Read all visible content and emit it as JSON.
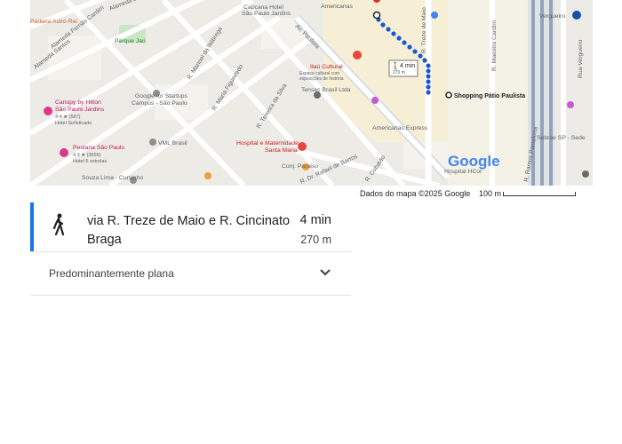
{
  "map": {
    "labels": {
      "alameda_jau": "Alameda Jaú",
      "parque_jau": "Parque Jaú",
      "ferraz": "Alameda Fernão Cardim",
      "santos": "Alameda Santos",
      "astro": "Padaria Astro Rei",
      "canopy_1": "Canopy by Hilton",
      "canopy_2": "São Paulo Jardins",
      "canopy_3": "4.4 ★ (587)",
      "canopy_4": "Hotel Sofisticado",
      "pestana_1": "Pestana São Paulo",
      "pestana_2": "4.3 ★ (3556)",
      "pestana_3": "Hotel 5 estrelas",
      "google_1": "Google for Startups",
      "google_2": "Campus - São Paulo",
      "vml": "VML Brasil",
      "capcana_1": "Capcana Hotel",
      "capcana_2": "São Paulo Jardins",
      "americanas": "Americanas",
      "paulista": "Av. Paulista",
      "nobrega": "R. Manoel da Nóbrega",
      "figueiredo": "R. Maria Figueiredo",
      "silva": "R. Teixeira da Silva",
      "hospital_1": "Hospital e Maternidade",
      "hospital_2": "Santa Maria",
      "itau_1": "Itaú Cultural",
      "itau_2": "Espaço cultural com",
      "itau_3": "exposições de história",
      "tensec": "Tensec Brasil Ltda",
      "express": "Americanas Express",
      "paraiso": "Conj. Paraíso",
      "barros": "R. Dr. Rafael de Barros",
      "cubatao": "R. Cubatão",
      "maio": "R. Treze de Maio",
      "mestre": "R. Maestro Cardim",
      "pamplona": "R. Ramos Pamplona",
      "vergueiro_road": "Rua Vergueiro",
      "vergueiro": "Vergueiro",
      "sebrae": "Sebrae SP - Sede",
      "souza": "Souza Lima - Cursinho",
      "tuttoia": "R. Tutóia",
      "hcor": "Hospital HCor",
      "shopping": "Shopping Pátio Paulista",
      "walk_time": "4 min",
      "walk_dist": "270 m",
      "google_logo": "Google"
    },
    "attribution": "Dados do mapa ©2025 Google",
    "scale_label": "100 m"
  },
  "route": {
    "name": "via R. Treze de Maio e R. Cincinato Braga",
    "time": "4 min",
    "distance": "270 m",
    "accent_color": "#1a73e8",
    "icon": "walking-person-icon"
  },
  "elevation": {
    "label": "Predominantemente plana",
    "icon": "chevron-down-icon"
  }
}
